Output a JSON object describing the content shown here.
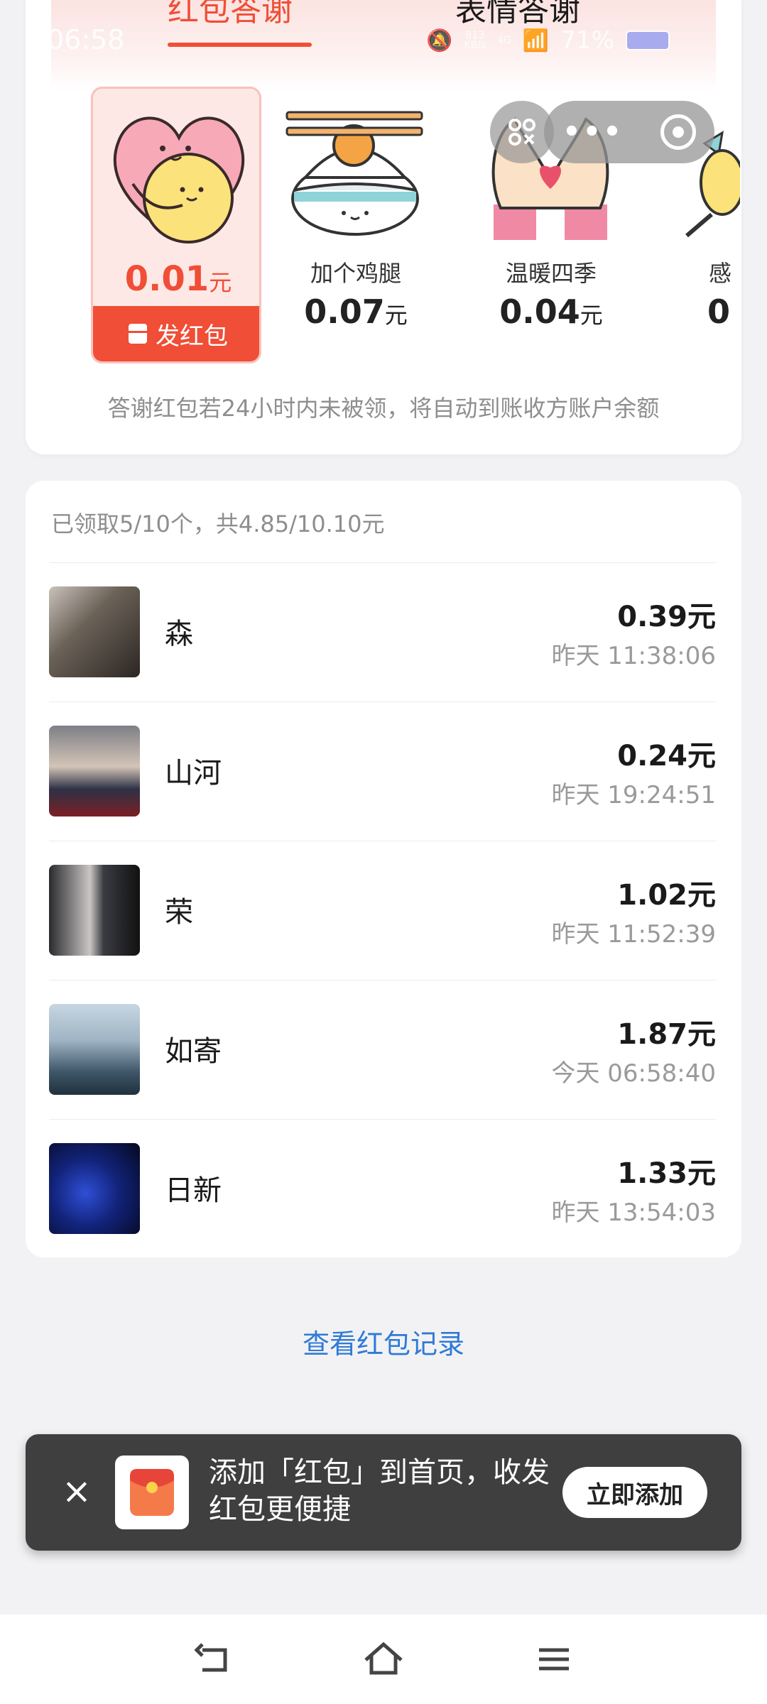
{
  "tabs": {
    "active": "红包答谢",
    "inactive": "表情答谢"
  },
  "status_bar": {
    "time": "06:58",
    "net_speed": "813",
    "net_unit": "KB/s",
    "signal": "4G",
    "battery": "71%"
  },
  "options": {
    "selected": {
      "amount": "0.01",
      "unit": "元",
      "send_label": "发红包",
      "icon": "heart-hug-sticker"
    },
    "items": [
      {
        "name": "加个鸡腿",
        "amount": "0.07",
        "unit": "元",
        "icon": "rice-bowl-drumstick-sticker"
      },
      {
        "name": "温暖四季",
        "amount": "0.04",
        "unit": "元",
        "icon": "heart-hands-sticker"
      },
      {
        "name": "感",
        "amount": "0",
        "unit": "",
        "icon": "partial-sticker"
      }
    ]
  },
  "notice": "答谢红包若24小时内未被领，将自动到账收方账户余额",
  "list": {
    "summary": "已领取5/10个，共4.85/10.10元",
    "rows": [
      {
        "name": "森",
        "amount": "0.39元",
        "time": "昨天 11:38:06"
      },
      {
        "name": "山河",
        "amount": "0.24元",
        "time": "昨天 19:24:51"
      },
      {
        "name": "荣",
        "amount": "1.02元",
        "time": "昨天 11:52:39"
      },
      {
        "name": "如寄",
        "amount": "1.87元",
        "time": "今天 06:58:40"
      },
      {
        "name": "日新",
        "amount": "1.33元",
        "time": "昨天 13:54:03"
      }
    ]
  },
  "view_record": "查看红包记录",
  "banner": {
    "text": "添加「红包」到首页，收发红包更便捷",
    "button": "立即添加"
  },
  "colors": {
    "accent": "#f04e36",
    "link": "#2f7ad6",
    "banner_bg": "#3f3f3f"
  }
}
